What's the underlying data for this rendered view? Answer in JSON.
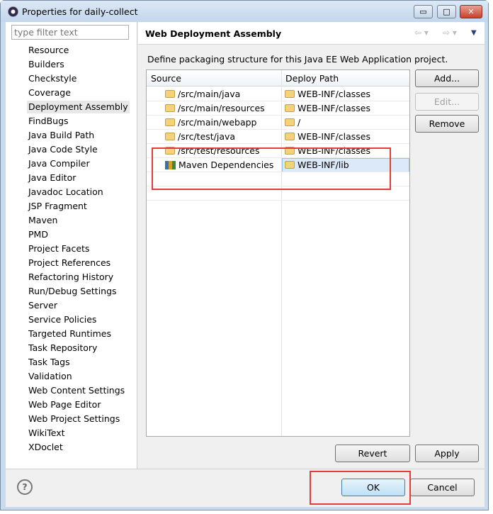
{
  "window": {
    "title": "Properties for daily-collect",
    "minimize": "▭",
    "maximize": "□",
    "close": "✕"
  },
  "sidebar": {
    "filter_placeholder": "type filter text",
    "items": [
      {
        "label": "Resource"
      },
      {
        "label": "Builders"
      },
      {
        "label": "Checkstyle"
      },
      {
        "label": "Coverage"
      },
      {
        "label": "Deployment Assembly",
        "selected": true
      },
      {
        "label": "FindBugs"
      },
      {
        "label": "Java Build Path"
      },
      {
        "label": "Java Code Style"
      },
      {
        "label": "Java Compiler"
      },
      {
        "label": "Java Editor"
      },
      {
        "label": "Javadoc Location"
      },
      {
        "label": "JSP Fragment"
      },
      {
        "label": "Maven"
      },
      {
        "label": "PMD"
      },
      {
        "label": "Project Facets"
      },
      {
        "label": "Project References"
      },
      {
        "label": "Refactoring History"
      },
      {
        "label": "Run/Debug Settings"
      },
      {
        "label": "Server"
      },
      {
        "label": "Service Policies"
      },
      {
        "label": "Targeted Runtimes"
      },
      {
        "label": "Task Repository"
      },
      {
        "label": "Task Tags"
      },
      {
        "label": "Validation"
      },
      {
        "label": "Web Content Settings"
      },
      {
        "label": "Web Page Editor"
      },
      {
        "label": "Web Project Settings"
      },
      {
        "label": "WikiText"
      },
      {
        "label": "XDoclet"
      }
    ]
  },
  "page": {
    "title": "Web Deployment Assembly",
    "nav_back": "⇦ ▾",
    "nav_fwd": "⇨ ▾",
    "menu": "▼",
    "description": "Define packaging structure for this Java EE Web Application project.",
    "columns": [
      "Source",
      "Deploy Path"
    ],
    "rows": [
      {
        "source": "/src/main/java",
        "deploy": "WEB-INF/classes",
        "icon": "folder-icon"
      },
      {
        "source": "/src/main/resources",
        "deploy": "WEB-INF/classes",
        "icon": "folder-icon"
      },
      {
        "source": "/src/main/webapp",
        "deploy": "/",
        "icon": "folder-icon"
      },
      {
        "source": "/src/test/java",
        "deploy": "WEB-INF/classes",
        "icon": "folder-icon"
      },
      {
        "source": "/src/test/resources",
        "deploy": "WEB-INF/classes",
        "icon": "folder-icon"
      },
      {
        "source": "Maven Dependencies",
        "deploy": "WEB-INF/lib",
        "icon": "maven-library-icon",
        "selected": true
      }
    ],
    "buttons": {
      "add": "Add...",
      "edit": "Edit...",
      "remove": "Remove",
      "revert": "Revert",
      "apply": "Apply"
    }
  },
  "footer": {
    "help": "?",
    "ok": "OK",
    "cancel": "Cancel"
  },
  "highlight_color": "#e53b3b"
}
